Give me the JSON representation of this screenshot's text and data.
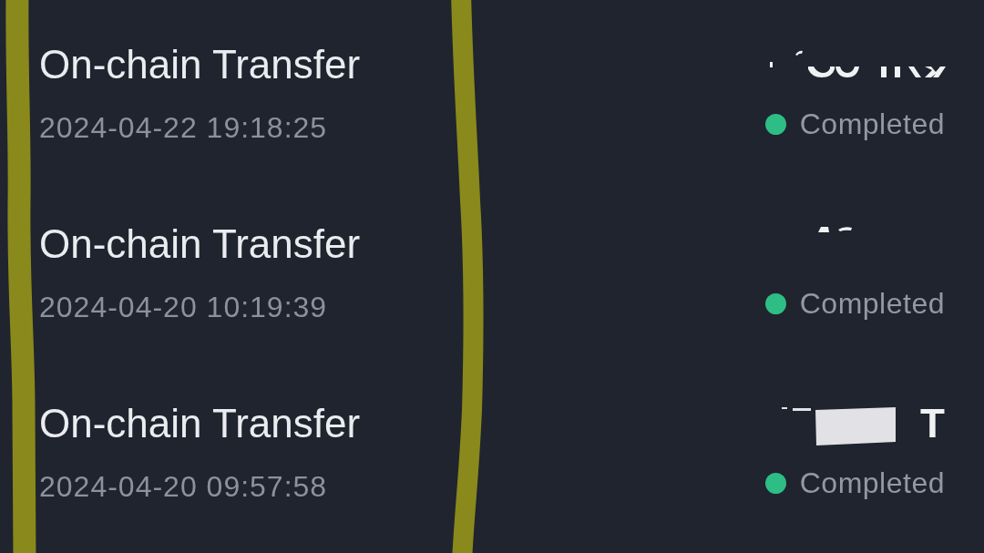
{
  "transactions": [
    {
      "title": "On-chain Transfer",
      "time": "2024-04-22 19:18:25",
      "amount": {
        "kind": "clipped"
      },
      "status": "Completed"
    },
    {
      "title": "On-chain Transfer",
      "time": "2024-04-20 10:19:39",
      "amount": {
        "kind": "fragment"
      },
      "status": "Completed"
    },
    {
      "title": "On-chain Transfer",
      "time": "2024-04-20 09:57:58",
      "amount": {
        "kind": "redacted",
        "text": "T"
      },
      "status": "Completed"
    }
  ]
}
